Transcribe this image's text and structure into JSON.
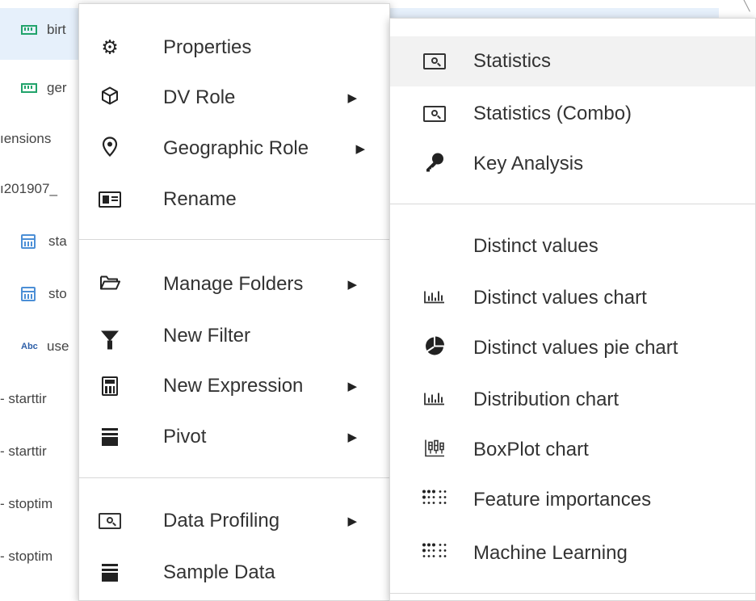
{
  "tree": {
    "rows": [
      {
        "text": "birt",
        "icon": "measure-icon"
      },
      {
        "text": "ger",
        "icon": "measure-icon"
      },
      {
        "text": "ıensions",
        "icon": ""
      },
      {
        "text": "ı201907_",
        "icon": ""
      },
      {
        "text": "sta",
        "icon": "calendar-icon"
      },
      {
        "text": "sto",
        "icon": "calendar-icon"
      },
      {
        "text": "use",
        "icon": "text-abc-icon"
      },
      {
        "text": "- starttir",
        "icon": ""
      },
      {
        "text": "- starttir",
        "icon": ""
      },
      {
        "text": "- stoptim",
        "icon": ""
      },
      {
        "text": "- stoptim",
        "icon": ""
      }
    ],
    "abc_label": "Abc"
  },
  "context_menu": {
    "items": [
      {
        "label": "Properties",
        "icon": "gear-icon",
        "submenu": false
      },
      {
        "label": "DV Role",
        "icon": "cube-icon",
        "submenu": true
      },
      {
        "label": "Geographic Role",
        "icon": "map-pin-icon",
        "submenu": true
      },
      {
        "label": "Rename",
        "icon": "id-card-icon",
        "submenu": false
      },
      {
        "label": "Manage Folders",
        "icon": "folder-open-icon",
        "submenu": true
      },
      {
        "label": "New Filter",
        "icon": "funnel-icon",
        "submenu": false
      },
      {
        "label": "New Expression",
        "icon": "calculator-icon",
        "submenu": true
      },
      {
        "label": "Pivot",
        "icon": "pivot-icon",
        "submenu": true
      },
      {
        "label": "Data Profiling",
        "icon": "scan-icon",
        "submenu": true
      },
      {
        "label": "Sample Data",
        "icon": "pivot-icon",
        "submenu": false
      }
    ]
  },
  "submenu": {
    "items": [
      {
        "label": "Statistics",
        "icon": "scan-icon",
        "hovered": true
      },
      {
        "label": "Statistics (Combo)",
        "icon": "scan-icon"
      },
      {
        "label": "Key Analysis",
        "icon": "key-icon"
      },
      {
        "label": "Distinct values",
        "icon": ""
      },
      {
        "label": "Distinct values chart",
        "icon": "bar-chart-icon"
      },
      {
        "label": "Distinct values pie chart",
        "icon": "pie-chart-icon"
      },
      {
        "label": "Distribution chart",
        "icon": "bar-chart-icon"
      },
      {
        "label": "BoxPlot chart",
        "icon": "boxplot-icon"
      },
      {
        "label": "Feature importances",
        "icon": "dots-grid-icon"
      },
      {
        "label": "Machine Learning",
        "icon": "dots-grid-icon"
      }
    ]
  },
  "colors": {
    "selected_row_bg": "#e6f0fb",
    "hover_bg": "#f2f2f2",
    "measure_icon": "#21a36b",
    "calendar_icon": "#4c8fd6"
  }
}
